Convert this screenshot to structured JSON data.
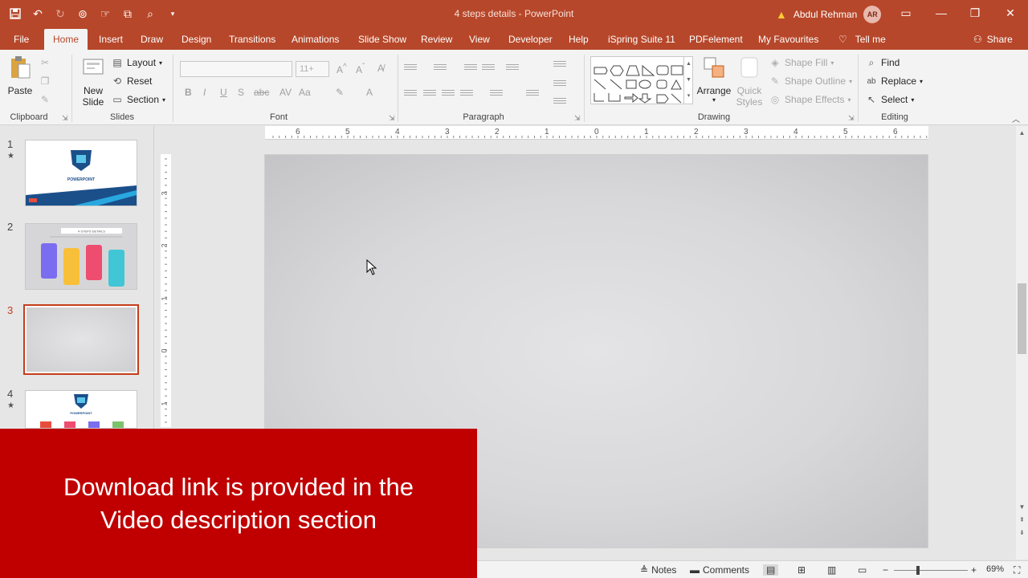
{
  "window": {
    "title": "4 steps details  -  PowerPoint",
    "user_name": "Abdul Rehman",
    "user_initials": "AR"
  },
  "tabs": [
    "File",
    "Home",
    "Insert",
    "Draw",
    "Design",
    "Transitions",
    "Animations",
    "Slide Show",
    "Review",
    "View",
    "Developer",
    "Help",
    "iSpring Suite 11",
    "PDFelement",
    "My Favourites",
    "Tell me"
  ],
  "share_label": "Share",
  "ribbon": {
    "clipboard": {
      "paste": "Paste",
      "label": "Clipboard"
    },
    "slides": {
      "new_slide_line1": "New",
      "new_slide_line2": "Slide",
      "layout": "Layout",
      "reset": "Reset",
      "section": "Section",
      "label": "Slides"
    },
    "font": {
      "size_placeholder": "11+",
      "label": "Font"
    },
    "paragraph": {
      "label": "Paragraph"
    },
    "drawing": {
      "arrange": "Arrange",
      "quick_styles_line1": "Quick",
      "quick_styles_line2": "Styles",
      "shape_fill": "Shape Fill",
      "shape_outline": "Shape Outline",
      "shape_effects": "Shape Effects",
      "label": "Drawing"
    },
    "editing": {
      "find": "Find",
      "replace": "Replace",
      "select": "Select",
      "label": "Editing"
    }
  },
  "thumbnails": [
    {
      "number": "1",
      "star": "★",
      "title": "POWERPOINT"
    },
    {
      "number": "2",
      "star": "",
      "title": "4 STEPS DETAILS"
    },
    {
      "number": "3",
      "star": "",
      "title": ""
    },
    {
      "number": "4",
      "star": "★",
      "title": "POWERPOINT"
    }
  ],
  "ruler": {
    "horizontal": [
      "6",
      "5",
      "4",
      "3",
      "2",
      "1",
      "0",
      "1",
      "2",
      "3",
      "4",
      "5",
      "6"
    ],
    "vertical": [
      "3",
      "2",
      "1",
      "0",
      "1"
    ]
  },
  "status": {
    "notes": "Notes",
    "comments": "Comments",
    "zoom": "69%"
  },
  "banner": {
    "line1": "Download link is provided in the",
    "line2": "Video description section"
  },
  "colors": {
    "accent": "#b7472a",
    "banner": "#c00000",
    "selected_thumb": "#c43e1c"
  }
}
